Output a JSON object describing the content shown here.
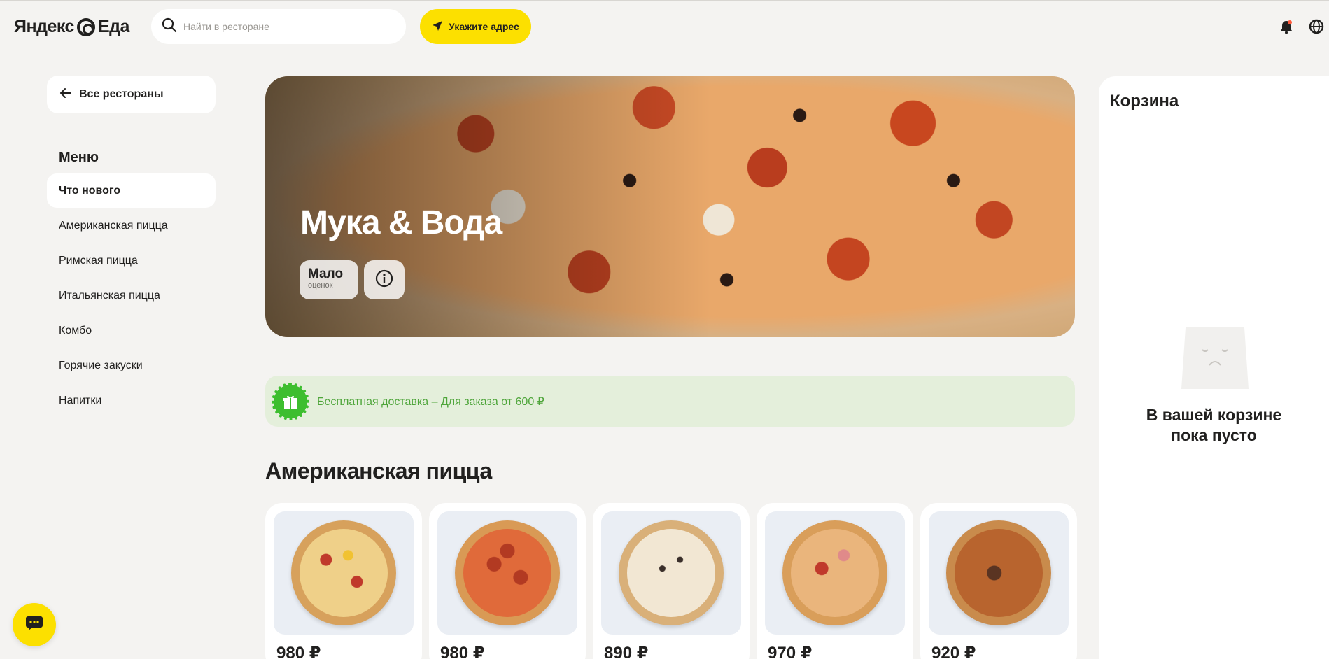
{
  "header": {
    "logo_text_1": "Яндекс",
    "logo_text_2": "Еда",
    "search_placeholder": "Найти в ресторане",
    "address_button_label": "Укажите адрес"
  },
  "sidebar": {
    "back_label": "Все рестораны",
    "menu_title": "Меню",
    "items": [
      {
        "label": "Что нового",
        "active": true
      },
      {
        "label": "Американская пицца"
      },
      {
        "label": "Римская пицца"
      },
      {
        "label": "Итальянская пицца"
      },
      {
        "label": "Комбо"
      },
      {
        "label": "Горячие закуски"
      },
      {
        "label": "Напитки"
      }
    ]
  },
  "restaurant": {
    "name": "Мука & Вода",
    "rating_value": "Мало",
    "rating_caption": "оценок"
  },
  "promo": {
    "text": "Бесплатная доставка – Для заказа от 600 ₽"
  },
  "section": {
    "title": "Американская пицца",
    "products": [
      {
        "price": "980 ₽"
      },
      {
        "price": "980 ₽"
      },
      {
        "price": "890 ₽"
      },
      {
        "price": "970 ₽"
      },
      {
        "price": "920 ₽"
      }
    ]
  },
  "cart": {
    "title": "Корзина",
    "empty_line_1": "В вашей корзине",
    "empty_line_2": "пока пусто"
  },
  "colors": {
    "accent_yellow": "#fce000",
    "promo_green": "#3dbe2f",
    "promo_bg": "#e4efdb",
    "background": "#f4f3f1"
  }
}
